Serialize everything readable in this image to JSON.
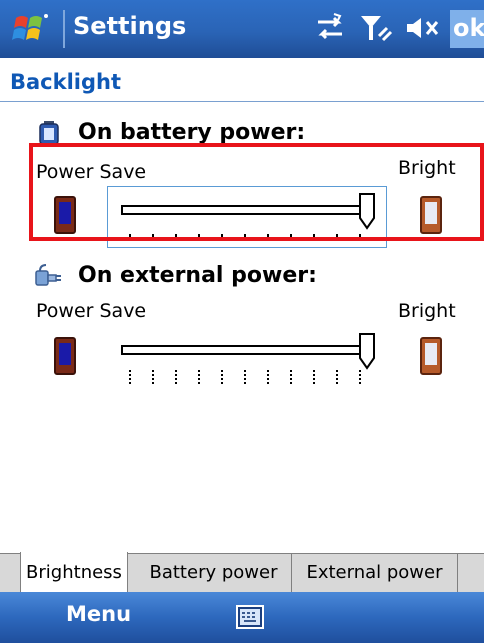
{
  "titlebar": {
    "title": "Settings",
    "ok_label": "ok",
    "icons": [
      "windows-start-logo",
      "connectivity-icon",
      "signal-icon",
      "volume-muted-icon"
    ]
  },
  "section": {
    "title": "Backlight"
  },
  "battery_group": {
    "title": "On battery power:",
    "icon": "battery-icon",
    "left_label": "Power Save",
    "right_label": "Bright",
    "level": 1.0
  },
  "external_group": {
    "title": "On external power:",
    "icon": "plug-icon",
    "left_label": "Power Save",
    "right_label": "Bright",
    "level": 1.0
  },
  "tabs": [
    {
      "label": "Brightness",
      "selected": true
    },
    {
      "label": "Battery power",
      "selected": false
    },
    {
      "label": "External power",
      "selected": false
    }
  ],
  "menubar": {
    "menu_label": "Menu",
    "icon": "keyboard-icon"
  },
  "colors": {
    "titlebar": "#2a64b6",
    "section_title": "#0f58b5",
    "highlight": "#e8141a"
  }
}
